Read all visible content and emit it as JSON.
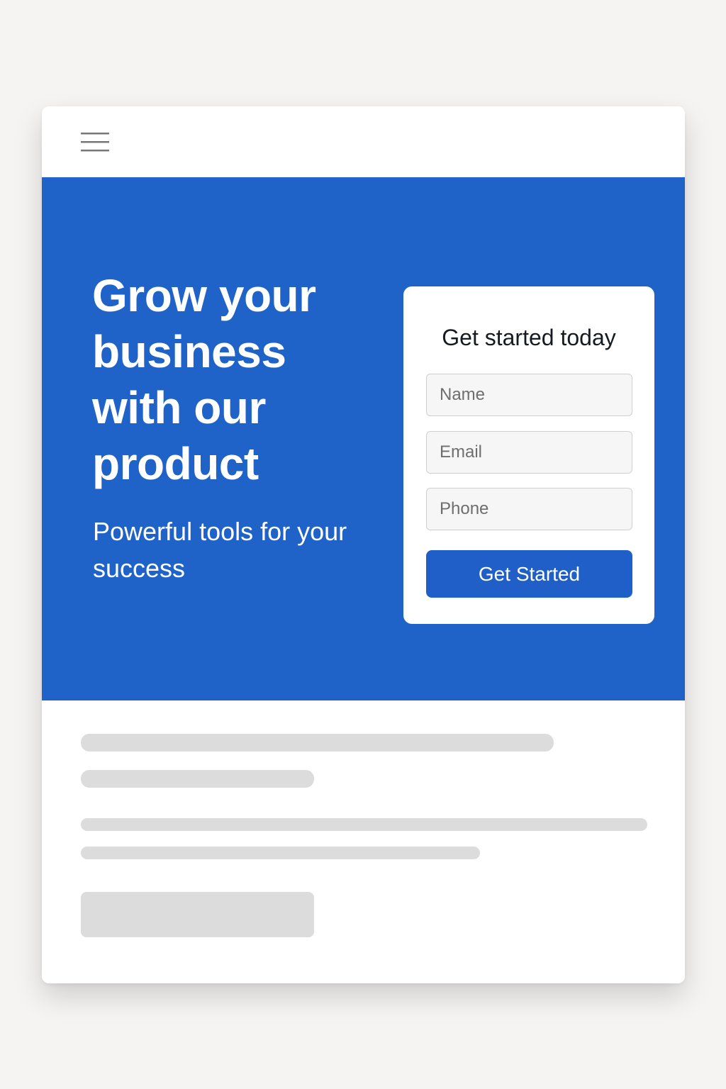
{
  "header": {
    "menu_icon": "hamburger-menu-icon"
  },
  "hero": {
    "title": "Grow your business with our product",
    "subtitle": "Powerful tools for your success",
    "background_color": "#1f62c8"
  },
  "signup_form": {
    "title": "Get started today",
    "fields": [
      {
        "placeholder": "Name",
        "value": ""
      },
      {
        "placeholder": "Email",
        "value": ""
      },
      {
        "placeholder": "Phone",
        "value": ""
      }
    ],
    "submit_label": "Get Started",
    "button_color": "#1f5fc7"
  },
  "content": {
    "state": "loading-placeholder"
  }
}
